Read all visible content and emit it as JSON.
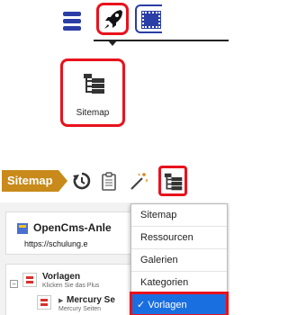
{
  "top_toolbar": {
    "icons": [
      "menu-icon",
      "rocket-icon",
      "select-area-icon"
    ]
  },
  "launcher": {
    "label": "Sitemap",
    "icon": "sitemap-tree-icon"
  },
  "sitemap_bar": {
    "title": "Sitemap",
    "icons": [
      "history-icon",
      "clipboard-icon",
      "magic-wand-icon",
      "sitemap-tree-icon"
    ]
  },
  "site": {
    "title": "OpenCms-Anle",
    "url": "https://schulung.e"
  },
  "tree": {
    "root_label": "Vorlagen",
    "root_subtitle": "Klicken Sie das Plus",
    "child_label": "Mercury Se",
    "child_subtitle": "Mercury Seiten"
  },
  "dropdown": {
    "items": [
      {
        "label": "Sitemap",
        "selected": false
      },
      {
        "label": "Ressourcen",
        "selected": false
      },
      {
        "label": "Galerien",
        "selected": false
      },
      {
        "label": "Kategorien",
        "selected": false
      },
      {
        "label": "Vorlagen",
        "selected": true
      }
    ],
    "check": "✓"
  },
  "colors": {
    "highlight": "#e8121c",
    "accent": "#2b3da6",
    "sitemap_badge": "#c88a1a",
    "selected_item": "#1a6fe0"
  }
}
